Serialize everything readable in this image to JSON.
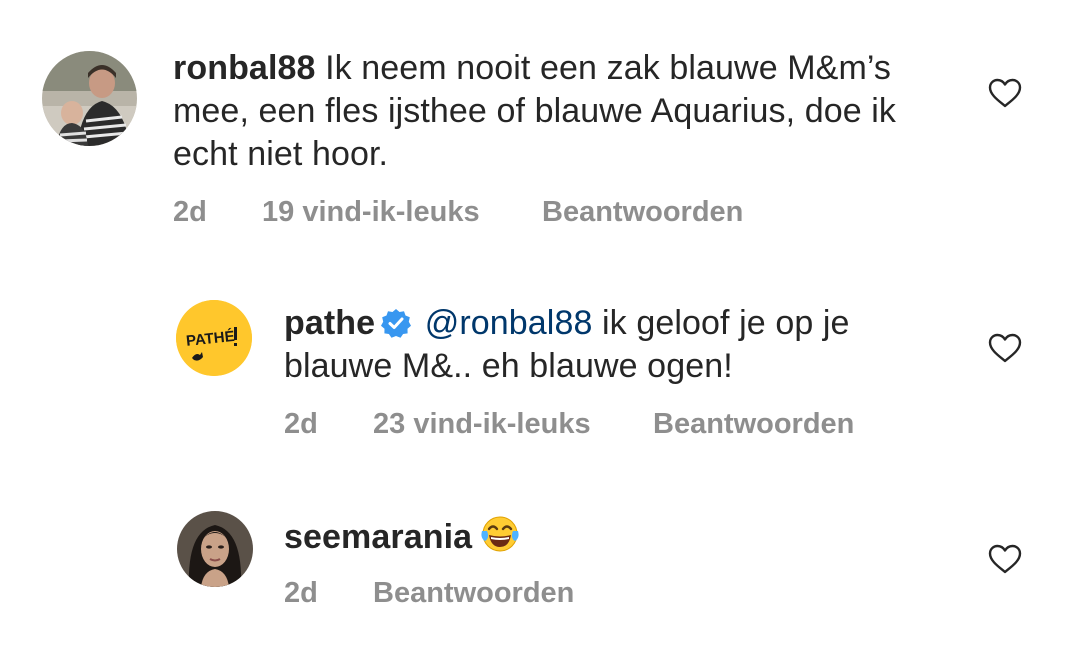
{
  "comments": [
    {
      "username": "ronbal88",
      "text": "Ik neem nooit een zak blauwe M&m’s mee, een fles ijsthee of blauwe Aquarius, doe ik echt niet hoor.",
      "avatar_icon": "profile-photo-two-people",
      "time": "2d",
      "likes": "19 vind-ik-leuks",
      "reply_label": "Beantwoorden",
      "like_icon": "heart-outline-icon"
    },
    {
      "username": "pathe",
      "verified": true,
      "verified_icon": "verified-badge-icon",
      "verified_color": "#3897f0",
      "mention": "@ronbal88",
      "text": "ik geloof je op je blauwe M&.. eh blauwe ogen!",
      "avatar_icon": "pathe-logo",
      "avatar_logo_text": "PATHÉ",
      "avatar_color": "#ffc72c",
      "time": "2d",
      "likes": "23 vind-ik-leuks",
      "reply_label": "Beantwoorden",
      "like_icon": "heart-outline-icon"
    },
    {
      "username": "seemarania",
      "emoji": "face-with-tears-of-joy",
      "avatar_icon": "profile-photo-woman",
      "time": "2d",
      "reply_label": "Beantwoorden",
      "like_icon": "heart-outline-icon"
    }
  ],
  "colors": {
    "text": "#262626",
    "secondary": "#8e8e8e",
    "mention": "#00376b",
    "background": "#ffffff"
  }
}
